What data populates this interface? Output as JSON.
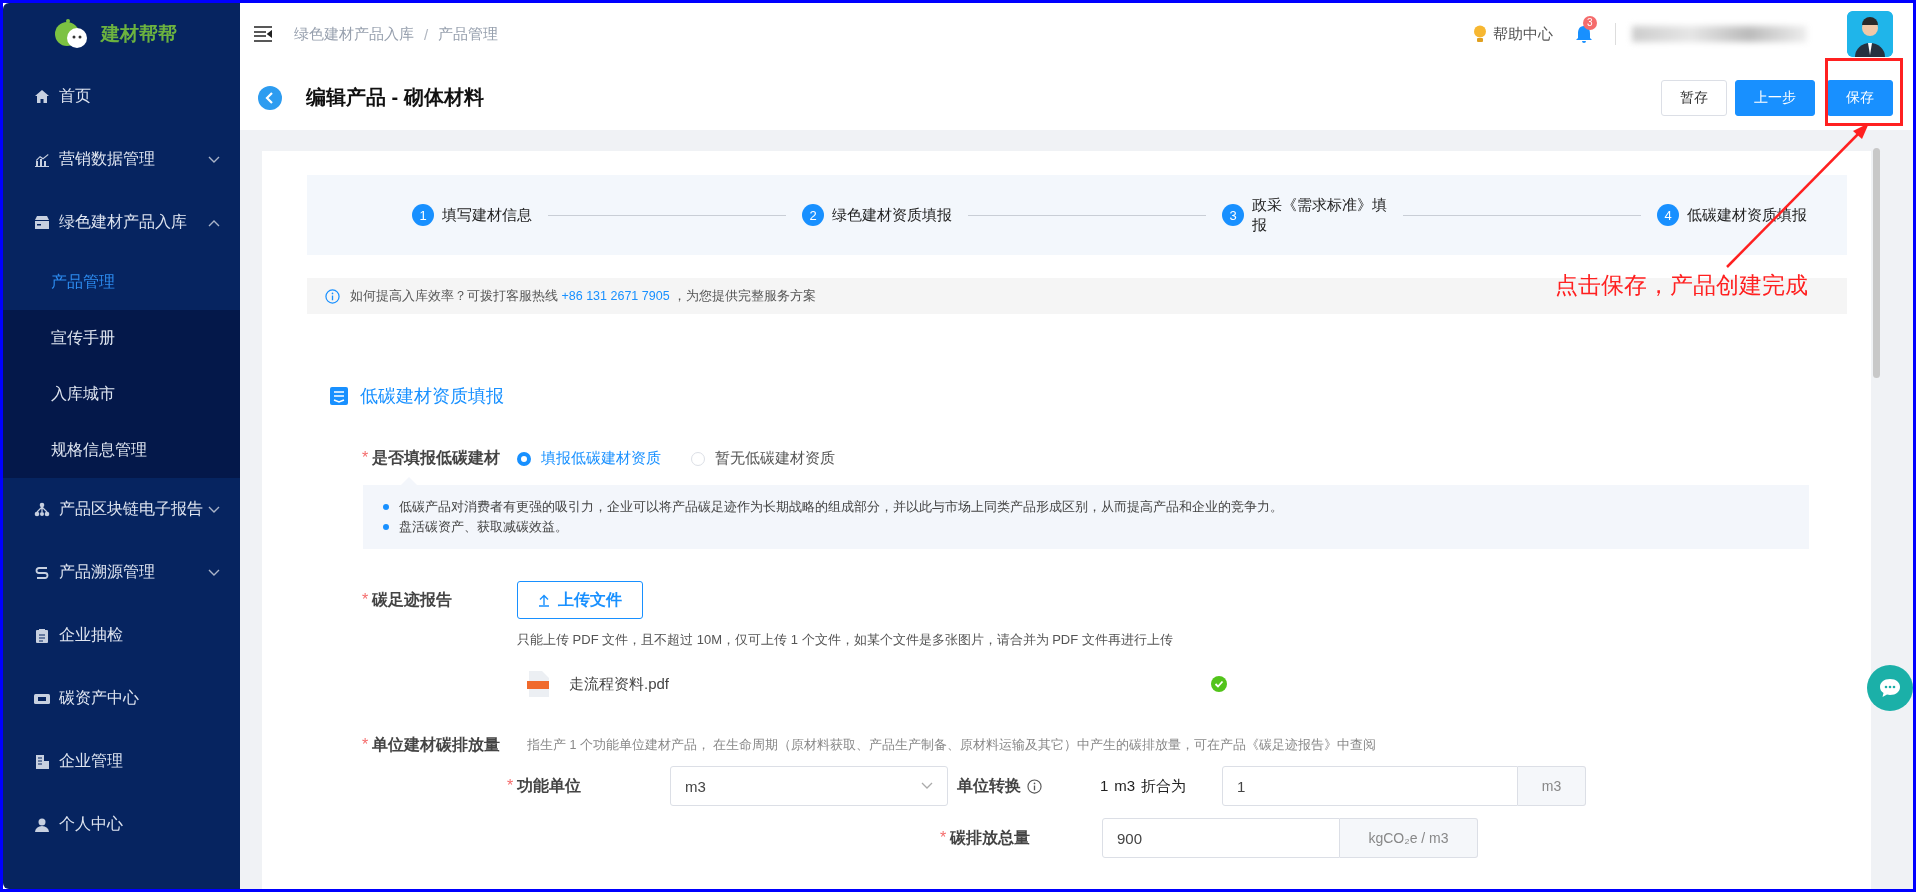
{
  "logo": {
    "text": "建材帮帮"
  },
  "sidebar": {
    "items": [
      {
        "label": "首页"
      },
      {
        "label": "营销数据管理",
        "expanded": false
      },
      {
        "label": "绿色建材产品入库",
        "expanded": true,
        "children": [
          {
            "label": "产品管理",
            "selected": true
          },
          {
            "label": "宣传手册",
            "selected": false
          },
          {
            "label": "入库城市",
            "selected": false
          },
          {
            "label": "规格信息管理",
            "selected": false
          }
        ]
      },
      {
        "label": "产品区块链电子报告",
        "expanded": false
      },
      {
        "label": "产品溯源管理",
        "expanded": false
      },
      {
        "label": "企业抽检"
      },
      {
        "label": "碳资产中心"
      },
      {
        "label": "企业管理"
      },
      {
        "label": "个人中心"
      }
    ]
  },
  "header": {
    "breadcrumb": [
      "绿色建材产品入库",
      "产品管理"
    ],
    "separator": "/",
    "help": "帮助中心",
    "notifications": "3"
  },
  "page": {
    "title": "编辑产品 - 砌体材料",
    "buttons": [
      {
        "label": "暂存",
        "kind": "default"
      },
      {
        "label": "上一步",
        "kind": "primary"
      },
      {
        "label": "保存",
        "kind": "primary"
      }
    ]
  },
  "annotation": {
    "text": "点击保存，产品创建完成"
  },
  "steps": [
    {
      "number": "1",
      "label": "填写建材信息"
    },
    {
      "number": "2",
      "label": "绿色建材资质填报"
    },
    {
      "number": "3",
      "label": "政采《需求标准》填报"
    },
    {
      "number": "4",
      "label": "低碳建材资质填报"
    }
  ],
  "info": {
    "text": "如何提高入库效率？可拨打客服热线 ",
    "phone": "+86 131 2671 7905",
    "suffix": " ，为您提供完整服务方案"
  },
  "section": {
    "title": "低碳建材资质填报"
  },
  "low_carbon": {
    "required_mark": "*",
    "label": "是否填报低碳建材",
    "options": [
      {
        "label": "填报低碳建材资质",
        "selected": true
      },
      {
        "label": "暂无低碳建材资质",
        "selected": false
      }
    ],
    "notes": [
      "低碳产品对消费者有更强的吸引力，企业可以将产品碳足迹作为长期战略的组成部分，并以此与市场上同类产品形成区别，从而提高产品和企业的竞争力。",
      "盘活碳资产、获取减碳效益。"
    ]
  },
  "report": {
    "required_mark": "*",
    "label": "碳足迹报告",
    "button": "上传文件",
    "hint": "只能上传 PDF 文件，且不超过 10M，仅可上传 1 个文件，如某个文件是多张图片，请合并为 PDF 文件再进行上传",
    "file": {
      "name": "走流程资料.pdf",
      "uploaded": true
    }
  },
  "emission": {
    "required_mark": "*",
    "label": "单位建材碳排放量",
    "hint": "指生产 1 个功能单位建材产品， 在生命周期（原材料获取、产品生产制备、原材料运输及其它）中产生的碳排放量，可在产品《碳足迹报告》中查阅"
  },
  "functional_unit": {
    "required_mark": "*",
    "label": "功能单位",
    "value": "m3"
  },
  "conversion": {
    "label": "单位转换",
    "amount": "1",
    "unit": "m3",
    "text": "折合为",
    "value": "1",
    "addon": "m3"
  },
  "total": {
    "required_mark": "*",
    "label": "碳排放总量",
    "value": "900",
    "addon": "kgCO₂e / m3"
  }
}
